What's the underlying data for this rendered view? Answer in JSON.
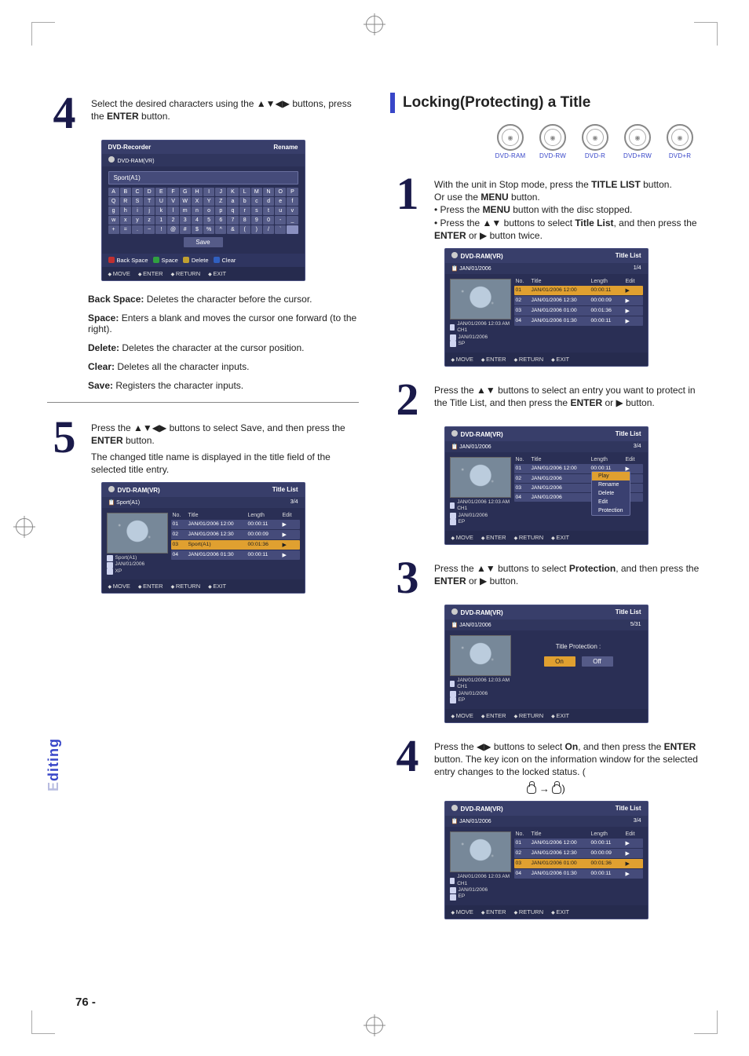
{
  "page_number": "76 -",
  "side_tab_full": "Editing",
  "section_title": "Locking(Protecting) a Title",
  "disc_labels": [
    "DVD-RAM",
    "DVD-RW",
    "DVD-R",
    "DVD+RW",
    "DVD+R"
  ],
  "left": {
    "step4_text_a": "Select the desired characters using the ▲▼◀▶ buttons, press the ",
    "step4_text_b": "ENTER",
    "step4_text_c": " button.",
    "osd_rename": {
      "title": "DVD-Recorder",
      "right": "Rename",
      "sub": "DVD-RAM(VR)",
      "field": "Sport(A1)",
      "save": "Save",
      "opts": [
        "Back Space",
        "Space",
        "Delete",
        "Clear"
      ],
      "nav": [
        "MOVE",
        "ENTER",
        "RETURN",
        "EXIT"
      ],
      "keys_r1": [
        "A",
        "B",
        "C",
        "D",
        "E",
        "F",
        "G",
        "H",
        "I",
        "J",
        "K",
        "L",
        "M",
        "N",
        "O",
        "P"
      ],
      "keys_r2": [
        "Q",
        "R",
        "S",
        "T",
        "U",
        "V",
        "W",
        "X",
        "Y",
        "Z",
        "a",
        "b",
        "c",
        "d",
        "e",
        "f"
      ],
      "keys_r3": [
        "g",
        "h",
        "i",
        "j",
        "k",
        "l",
        "m",
        "n",
        "o",
        "p",
        "q",
        "r",
        "s",
        "t",
        "u",
        "v"
      ],
      "keys_r4": [
        "w",
        "x",
        "y",
        "z",
        "1",
        "2",
        "3",
        "4",
        "5",
        "6",
        "7",
        "8",
        "9",
        "0",
        "-",
        "_"
      ],
      "keys_r5": [
        "+",
        "=",
        ".",
        "~",
        "!",
        "@",
        "#",
        "$",
        "%",
        "^",
        "&",
        "(",
        ")",
        "/",
        "`",
        " "
      ]
    },
    "terms": {
      "back_space_l": "Back Space:",
      "back_space_d": "Deletes the character before the cursor.",
      "space_l": "Space:",
      "space_d": "Enters a blank and moves the cursor one forward (to the right).",
      "delete_l": "Delete:",
      "delete_d": "Deletes the character at the cursor position.",
      "clear_l": "Clear:",
      "clear_d": "Deletes all the character inputs.",
      "save_l": "Save:",
      "save_d": "Registers the character inputs."
    },
    "step5_text_a": "Press the ▲▼◀▶ buttons to select Save, and then press the ",
    "step5_text_b": "ENTER",
    "step5_text_c": " button.",
    "step5_sub": "The changed title name is displayed in the title field of the selected title entry.",
    "osd_title_list": {
      "header_l": "DVD-RAM(VR)",
      "header_r": "Title List",
      "sub_l": "Sport(A1)",
      "sub_r": "3/4",
      "cols": [
        "No.",
        "Title",
        "Length",
        "Edit"
      ],
      "rows": [
        {
          "no": "01",
          "title": "JAN/01/2006 12:00",
          "len": "00:00:11",
          "edit": "▶",
          "sel": false
        },
        {
          "no": "02",
          "title": "JAN/01/2006 12:30",
          "len": "00:00:09",
          "edit": "▶",
          "sel": false
        },
        {
          "no": "03",
          "title": "Sport(A1)",
          "len": "00:01:36",
          "edit": "▶",
          "sel": true
        },
        {
          "no": "04",
          "title": "JAN/01/2006 01:30",
          "len": "00:00:11",
          "edit": "▶",
          "sel": false
        }
      ],
      "meta1": "Sport(A1)",
      "meta2": "JAN/01/2006",
      "meta3": "XP",
      "nav": [
        "MOVE",
        "ENTER",
        "RETURN",
        "EXIT"
      ]
    }
  },
  "right": {
    "step1": {
      "line1a": "With the unit in Stop mode, press the ",
      "line1b": "TITLE LIST",
      "line1c": " button.",
      "line2": "Or use the ",
      "line2b": "MENU",
      "line2c": " button.",
      "bullet1a": "• Press the ",
      "bullet1b": "MENU",
      "bullet1c": " button with the disc stopped.",
      "bullet2a": "• Press the ▲▼ buttons to select ",
      "bullet2b": "Title List",
      "bullet2c": ", and then press the ",
      "bullet2d": "ENTER",
      "bullet2e": " or ▶ button twice."
    },
    "osd1": {
      "header_l": "DVD-RAM(VR)",
      "header_r": "Title List",
      "sub_l": "JAN/01/2006",
      "sub_r": "1/4",
      "cols": [
        "No.",
        "Title",
        "Length",
        "Edit"
      ],
      "rows": [
        {
          "no": "01",
          "title": "JAN/01/2006 12:00",
          "len": "00:00:11",
          "edit": "▶",
          "sel": true
        },
        {
          "no": "02",
          "title": "JAN/01/2006 12:30",
          "len": "00:00:09",
          "edit": "▶",
          "sel": false
        },
        {
          "no": "03",
          "title": "JAN/01/2006 01:00",
          "len": "00:01:36",
          "edit": "▶",
          "sel": false
        },
        {
          "no": "04",
          "title": "JAN/01/2006 01:30",
          "len": "00:00:11",
          "edit": "▶",
          "sel": false
        }
      ],
      "meta1": "JAN/01/2006 12:03 AM CH1",
      "meta2": "JAN/01/2006",
      "meta3": "SP",
      "nav": [
        "MOVE",
        "ENTER",
        "RETURN",
        "EXIT"
      ]
    },
    "step2": {
      "a": "Press the ▲▼ buttons to select an entry you want to protect in the Title List, and then press the ",
      "b": "ENTER",
      "c": " or ▶ button."
    },
    "osd2": {
      "header_l": "DVD-RAM(VR)",
      "header_r": "Title List",
      "sub_l": "JAN/01/2006",
      "sub_r": "3/4",
      "cols": [
        "No.",
        "Title",
        "Length",
        "Edit"
      ],
      "rows": [
        {
          "no": "01",
          "title": "JAN/01/2006 12:00",
          "len": "00:00:11",
          "edit": "▶"
        },
        {
          "no": "02",
          "title": "JAN/01/2006",
          "len": "",
          "edit": ""
        },
        {
          "no": "03",
          "title": "JAN/01/2006",
          "len": "",
          "edit": ""
        },
        {
          "no": "04",
          "title": "JAN/01/2006",
          "len": "",
          "edit": ""
        }
      ],
      "popup": [
        "Play",
        "Rename",
        "Delete",
        "Edit",
        "Protection"
      ],
      "meta1": "JAN/01/2006 12:03 AM CH1",
      "meta2": "JAN/01/2006",
      "meta3": "EP",
      "nav": [
        "MOVE",
        "ENTER",
        "RETURN",
        "EXIT"
      ]
    },
    "step3": {
      "a": "Press the ▲▼ buttons to select ",
      "b": "Protection",
      "c": ", and then press the ",
      "d": "ENTER",
      "e": " or ▶ button."
    },
    "osd3": {
      "header_l": "DVD-RAM(VR)",
      "header_r": "Title List",
      "sub_l": "JAN/01/2006",
      "sub_r": "5/31",
      "msg": "Title Protection :",
      "on": "On",
      "off": "Off",
      "meta1": "JAN/01/2006 12:03 AM CH1",
      "meta2": "JAN/01/2006",
      "meta3": "EP",
      "nav": [
        "MOVE",
        "ENTER",
        "RETURN",
        "EXIT"
      ]
    },
    "step4": {
      "a": "Press the ◀▶ buttons to select ",
      "b": "On",
      "c": ", and then press the ",
      "d": "ENTER",
      "e": " button. The key icon on the information window for the selected entry changes to the locked status. (",
      "f": "→",
      "g": ")"
    },
    "osd4": {
      "header_l": "DVD-RAM(VR)",
      "header_r": "Title List",
      "sub_l": "JAN/01/2006",
      "sub_r": "3/4",
      "cols": [
        "No.",
        "Title",
        "Length",
        "Edit"
      ],
      "rows": [
        {
          "no": "01",
          "title": "JAN/01/2006 12:00",
          "len": "00:00:11",
          "edit": "▶",
          "sel": false
        },
        {
          "no": "02",
          "title": "JAN/01/2006 12:30",
          "len": "00:00:09",
          "edit": "▶",
          "sel": false
        },
        {
          "no": "03",
          "title": "JAN/01/2006 01:00",
          "len": "00:01:36",
          "edit": "▶",
          "sel": true
        },
        {
          "no": "04",
          "title": "JAN/01/2006 01:30",
          "len": "00:00:11",
          "edit": "▶",
          "sel": false
        }
      ],
      "meta1": "JAN/01/2006 12:03 AM CH1",
      "meta2": "JAN/01/2006",
      "meta3": "EP",
      "nav": [
        "MOVE",
        "ENTER",
        "RETURN",
        "EXIT"
      ]
    }
  }
}
